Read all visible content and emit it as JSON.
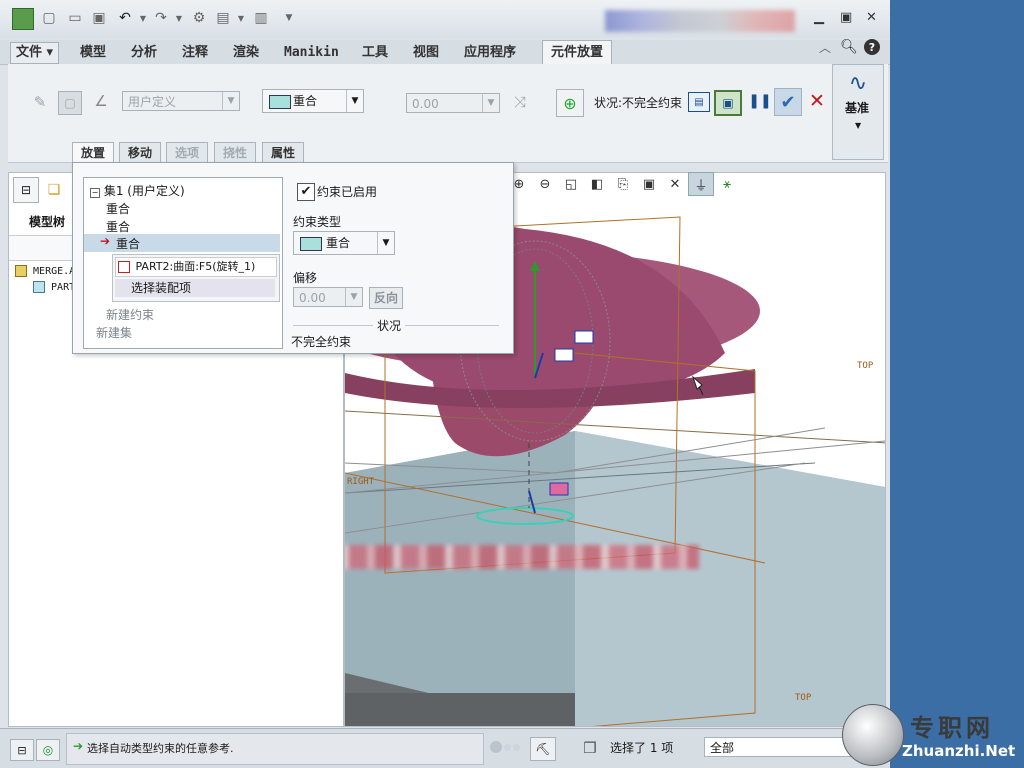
{
  "menu": {
    "file": "文件",
    "tabs": [
      "模型",
      "分析",
      "注释",
      "渲染",
      "Manikin",
      "工具",
      "视图",
      "应用程序"
    ],
    "active": "元件放置"
  },
  "ribbon": {
    "user_defined": "用户定义",
    "constraint_type": "重合",
    "offset_value": "0.00",
    "status": "状况:不完全约束",
    "datum": "基准"
  },
  "subtabs": [
    "放置",
    "移动",
    "选项",
    "挠性",
    "属性"
  ],
  "left_tabs": {
    "model_tree": "模型树"
  },
  "model_tree": [
    "MERGE.A",
    "PART"
  ],
  "placement": {
    "tree": {
      "set": "集1 (用户定义)",
      "items": [
        "重合",
        "重合",
        "重合"
      ],
      "ref1": "PART2:曲面:F5(旋转_1)",
      "ref2": "选择装配项",
      "new_constraint": "新建约束",
      "new_set": "新建集"
    },
    "enabled_label": "约束已启用",
    "type_label": "约束类型",
    "type_value": "重合",
    "offset_label": "偏移",
    "offset_value": "0.00",
    "flip": "反向",
    "status_group": "状况",
    "status_text": "不完全约束"
  },
  "viewport": {
    "label_top": "TOP",
    "label_right": "RIGHT",
    "label_top2": "TOP"
  },
  "statusbar": {
    "message": "选择自动类型约束的任意参考.",
    "selected": "选择了 1 项",
    "filter": "全部"
  },
  "watermark": {
    "cn": "专职网",
    "url": "Zhuanzhi.Net"
  }
}
